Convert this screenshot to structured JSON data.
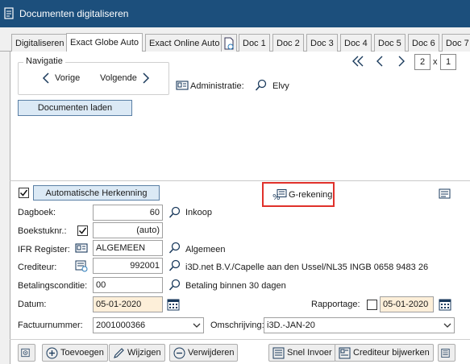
{
  "window": {
    "title": "Documenten digitaliseren"
  },
  "tabs": [
    {
      "label": "Digitaliseren"
    },
    {
      "label": "Exact Globe Auto"
    },
    {
      "label": "Exact Online Auto"
    },
    {
      "label": "Doc 1"
    },
    {
      "label": "Doc 2"
    },
    {
      "label": "Doc 3"
    },
    {
      "label": "Doc 4"
    },
    {
      "label": "Doc 5"
    },
    {
      "label": "Doc 6"
    },
    {
      "label": "Doc 7"
    }
  ],
  "navigation": {
    "legend": "Navigatie",
    "prev_label": "Vorige",
    "next_label": "Volgende"
  },
  "pager": {
    "current": "2",
    "separator": "x",
    "total": "1"
  },
  "administration": {
    "label": "Administratie:",
    "value": "Elvy"
  },
  "load_button": "Documenten laden",
  "recognition": {
    "checked": true,
    "button_label": "Automatische Herkenning",
    "g_rekening_label": "G-rekening"
  },
  "form": {
    "dagboek": {
      "label": "Dagboek:",
      "value": "60",
      "description": "Inkoop"
    },
    "boekstuknr": {
      "label": "Boekstuknr.:",
      "checked": true,
      "value": "(auto)"
    },
    "ifr_register": {
      "label": "IFR Register:",
      "value": "ALGEMEEN",
      "description": "Algemeen"
    },
    "crediteur": {
      "label": "Crediteur:",
      "value": "992001",
      "description": "i3D.net B.V./Capelle aan den Ussel/NL35 INGB 0658 9483 26"
    },
    "betalingsconditie": {
      "label": "Betalingsconditie:",
      "value": "00",
      "description": "Betaling binnen 30 dagen"
    },
    "datum": {
      "label": "Datum:",
      "value": "05-01-2020"
    },
    "rapportage": {
      "label": "Rapportage:",
      "checked": false,
      "value": "05-01-2020"
    },
    "factuurnummer": {
      "label": "Factuurnummer:",
      "value": "2001000366"
    },
    "omschrijving": {
      "label": "Omschrijving:",
      "value": "i3D.-JAN-20"
    }
  },
  "toolbar": {
    "add": "Toevoegen",
    "edit": "Wijzigen",
    "delete": "Verwijderen",
    "quick_entry": "Snel Invoer",
    "update_creditor": "Crediteur bijwerken"
  },
  "colors": {
    "titlebar": "#1c4f7c",
    "highlight": "#e0312b",
    "date_field": "#fdefd9",
    "primary_button": "#dbe9f5"
  }
}
